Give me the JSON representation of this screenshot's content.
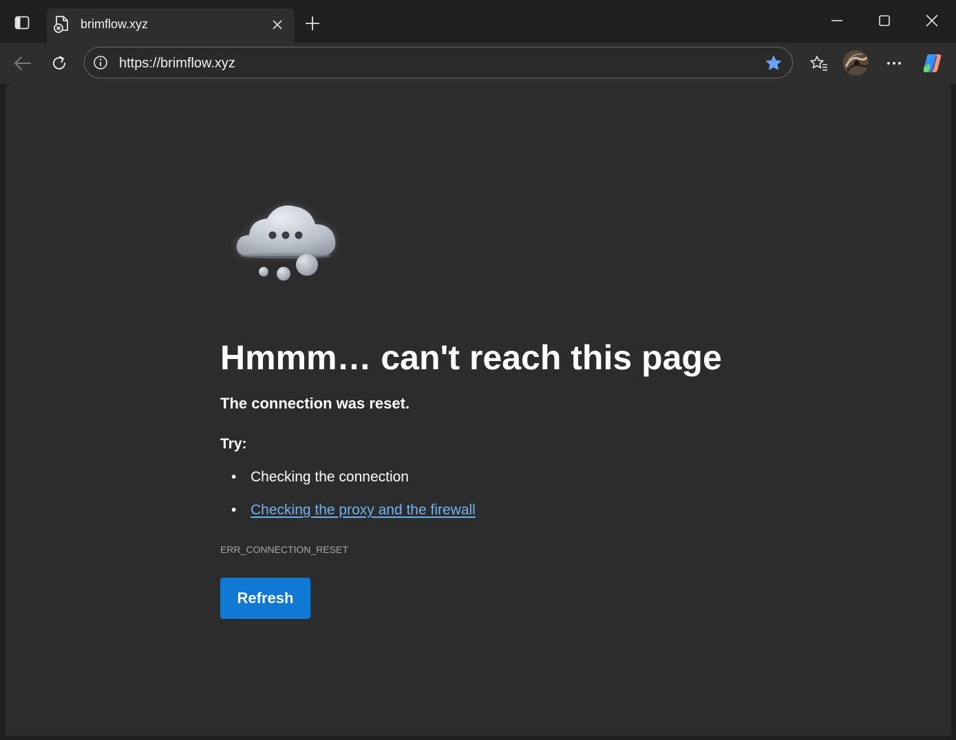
{
  "tab": {
    "title": "brimflow.xyz"
  },
  "omnibox": {
    "url": "https://brimflow.xyz"
  },
  "icons": {
    "tab_actions": "tab-actions-icon",
    "favicon": "error-page-icon",
    "tab_close": "close-icon",
    "new_tab": "plus-icon",
    "minimize": "minimize-icon",
    "maximize": "maximize-icon",
    "close_window": "close-icon",
    "back": "back-arrow-icon",
    "refresh": "refresh-icon",
    "site_info": "info-icon",
    "add_favorite": "star-icon",
    "favorites": "favorites-icon",
    "profile": "avatar",
    "more": "more-icon",
    "copilot": "copilot-icon"
  },
  "error": {
    "heading": "Hmmm… can't reach this page",
    "subtitle": "The connection was reset.",
    "try_label": "Try:",
    "suggestions": [
      "Checking the connection",
      "Checking the proxy and the firewall"
    ],
    "code": "ERR_CONNECTION_RESET",
    "refresh_label": "Refresh"
  },
  "colors": {
    "accent": "#0f78d4",
    "link": "#6fb4f0",
    "star": "#6aa3f5",
    "background": "#2c2c2c"
  }
}
